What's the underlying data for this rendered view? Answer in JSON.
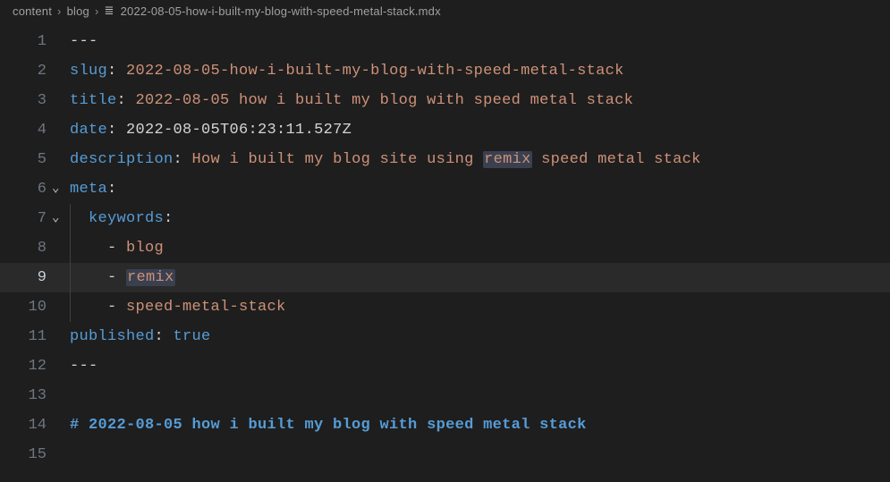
{
  "breadcrumb": {
    "segments": [
      "content",
      "blog"
    ],
    "filename": "2022-08-05-how-i-built-my-blog-with-speed-metal-stack.mdx"
  },
  "editor": {
    "current_line": 9,
    "lines": {
      "l1": "---",
      "l2": {
        "key": "slug",
        "value": "2022-08-05-how-i-built-my-blog-with-speed-metal-stack"
      },
      "l3": {
        "key": "title",
        "value": "2022-08-05 how i built my blog with speed metal stack"
      },
      "l4": {
        "key": "date",
        "value": "2022-08-05T06:23:11.527Z"
      },
      "l5": {
        "key": "description",
        "value_pre": "How i built my blog site using ",
        "value_hl": "remix",
        "value_post": " speed metal stack"
      },
      "l6": {
        "key": "meta"
      },
      "l7": {
        "key": "keywords"
      },
      "l8": {
        "item": "blog"
      },
      "l9": {
        "item": "remix"
      },
      "l10": {
        "item": "speed-metal-stack"
      },
      "l11": {
        "key": "published",
        "value": "true"
      },
      "l12": "---",
      "l14": "# 2022-08-05 how i built my blog with speed metal stack"
    }
  }
}
